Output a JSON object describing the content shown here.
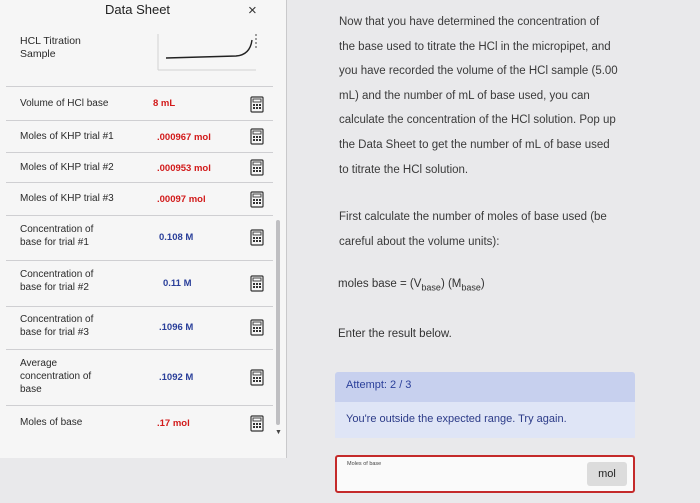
{
  "sheet": {
    "title": "Data Sheet",
    "close": "×",
    "sample_label": "HCL Titration\nSample",
    "rows": [
      {
        "label": "Volume of HCl base",
        "value": "8 mL"
      },
      {
        "label": "Moles of KHP trial #1",
        "value": ".000967 mol"
      },
      {
        "label": "Moles of KHP trial #2",
        "value": ".000953 mol"
      },
      {
        "label": "Moles of KHP trial #3",
        "value": ".00097 mol"
      },
      {
        "label": "Concentration of\nbase for trial #1",
        "value": "0.108 M"
      },
      {
        "label": "Concentration of\nbase for trial #2",
        "value": "0.11 M"
      },
      {
        "label": "Concentration of\nbase for trial #3",
        "value": ".1096 M"
      },
      {
        "label": "Average\nconcentration of\nbase",
        "value": ".1092 M"
      },
      {
        "label": "Moles of base",
        "value": ".17 mol"
      }
    ]
  },
  "instructions": {
    "lines": [
      "Now that you have determined the concentration of",
      "the base used to titrate the HCl in the micropipet, and",
      "you have recorded the volume of the HCl sample (5.00",
      "mL) and the number of mL of base used, you can",
      "calculate the concentration of the HCl solution. Pop up",
      "the Data Sheet to get the number of mL of base used",
      "to titrate the HCl solution."
    ],
    "first_calc_lines": [
      "First calculate the number of moles of base used (be",
      "careful about the volume units):"
    ],
    "formula_prefix": "moles base = (V",
    "formula_sub1": "base",
    "formula_mid": ") (M",
    "formula_sub2": "base",
    "formula_suffix": ")",
    "enter_result": "Enter the result below."
  },
  "attempt": {
    "text": "Attempt: 2 / 3"
  },
  "feedback": {
    "text": "You're outside the expected range. Try again."
  },
  "answer": {
    "label": "Moles of base",
    "value": "",
    "unit": "mol"
  },
  "colors": {
    "value_red": "#d21a1a",
    "value_blue": "#2a3f9a",
    "error_border": "#c42a2a"
  },
  "icons": [
    "close-icon",
    "calculator-icon",
    "scroll-down-icon"
  ]
}
